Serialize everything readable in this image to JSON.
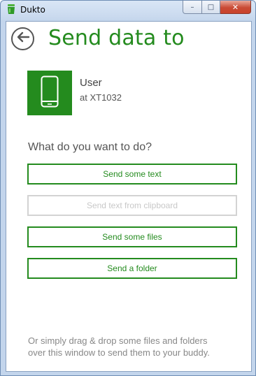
{
  "window": {
    "title": "Dukto",
    "controls": {
      "minimize": "–",
      "maximize": "□",
      "close": "✕"
    }
  },
  "header": {
    "back_icon": "arrow-left-icon",
    "title": "Send data to"
  },
  "buddy": {
    "device_icon": "smartphone-icon",
    "name": "User",
    "host": "at XT1032"
  },
  "actions": {
    "question": "What do you want to do?",
    "send_text": "Send some text",
    "send_clipboard": "Send text from clipboard",
    "send_files": "Send some files",
    "send_folder": "Send a folder"
  },
  "hint": {
    "line1": "Or simply drag & drop some files and folders",
    "line2": "over this window to send them to your buddy."
  },
  "colors": {
    "accent": "#248b1e",
    "disabled": "#c8c8c8"
  }
}
